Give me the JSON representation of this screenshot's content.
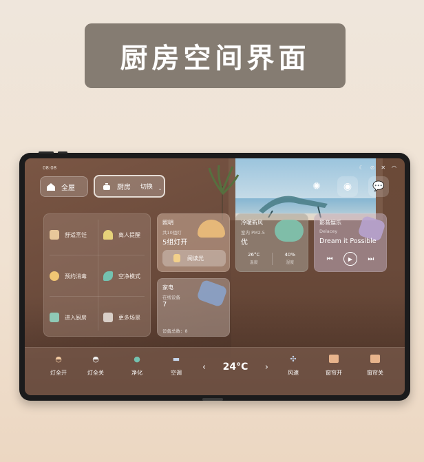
{
  "banner": {
    "title": "厨房空间界面"
  },
  "status": {
    "time": "08:08"
  },
  "header": {
    "home_label": "全屋",
    "room_label": "厨房",
    "switch_label": "切换"
  },
  "scenes": [
    {
      "label": "舒适烹饪",
      "icon": "pot-icon",
      "color": "#e8c79a"
    },
    {
      "label": "离人提醒",
      "icon": "lamp-icon",
      "color": "#e6d27a"
    },
    {
      "label": "预约消毒",
      "icon": "sun-icon",
      "color": "#f1c674"
    },
    {
      "label": "空净模式",
      "icon": "leaf-icon",
      "color": "#74c2b0"
    },
    {
      "label": "进入厨房",
      "icon": "house-icon",
      "color": "#8fc9b6"
    },
    {
      "label": "更多场景",
      "icon": "grid-icon",
      "color": "#d9cfc8"
    }
  ],
  "lighting": {
    "title": "照明",
    "subtitle": "共10组灯",
    "status": "5组灯开",
    "read_label": "阅读光"
  },
  "fresh_air": {
    "title": "冷暖新风",
    "subtitle": "室内 PM2.5",
    "quality": "优",
    "temperature": "26°C",
    "temperature_label": "温度",
    "humidity": "40%",
    "humidity_label": "湿度"
  },
  "media": {
    "title": "影音娱乐",
    "artist": "Delacey",
    "song": "Dream it Possible"
  },
  "appliance": {
    "title": "家电",
    "subtitle": "在线设备",
    "count": "7",
    "total_label": "设备总数：8"
  },
  "bottom": {
    "lights_on": "灯全开",
    "lights_off": "灯全关",
    "purify": "净化",
    "ac": "空调",
    "temperature": "24°C",
    "fan": "风速",
    "curtain_open": "窗帘开",
    "curtain_close": "窗帘关"
  },
  "colors": {
    "banner_bg": "#857c72",
    "accent_teal": "#74c2b0",
    "accent_amber": "#f1c674"
  }
}
